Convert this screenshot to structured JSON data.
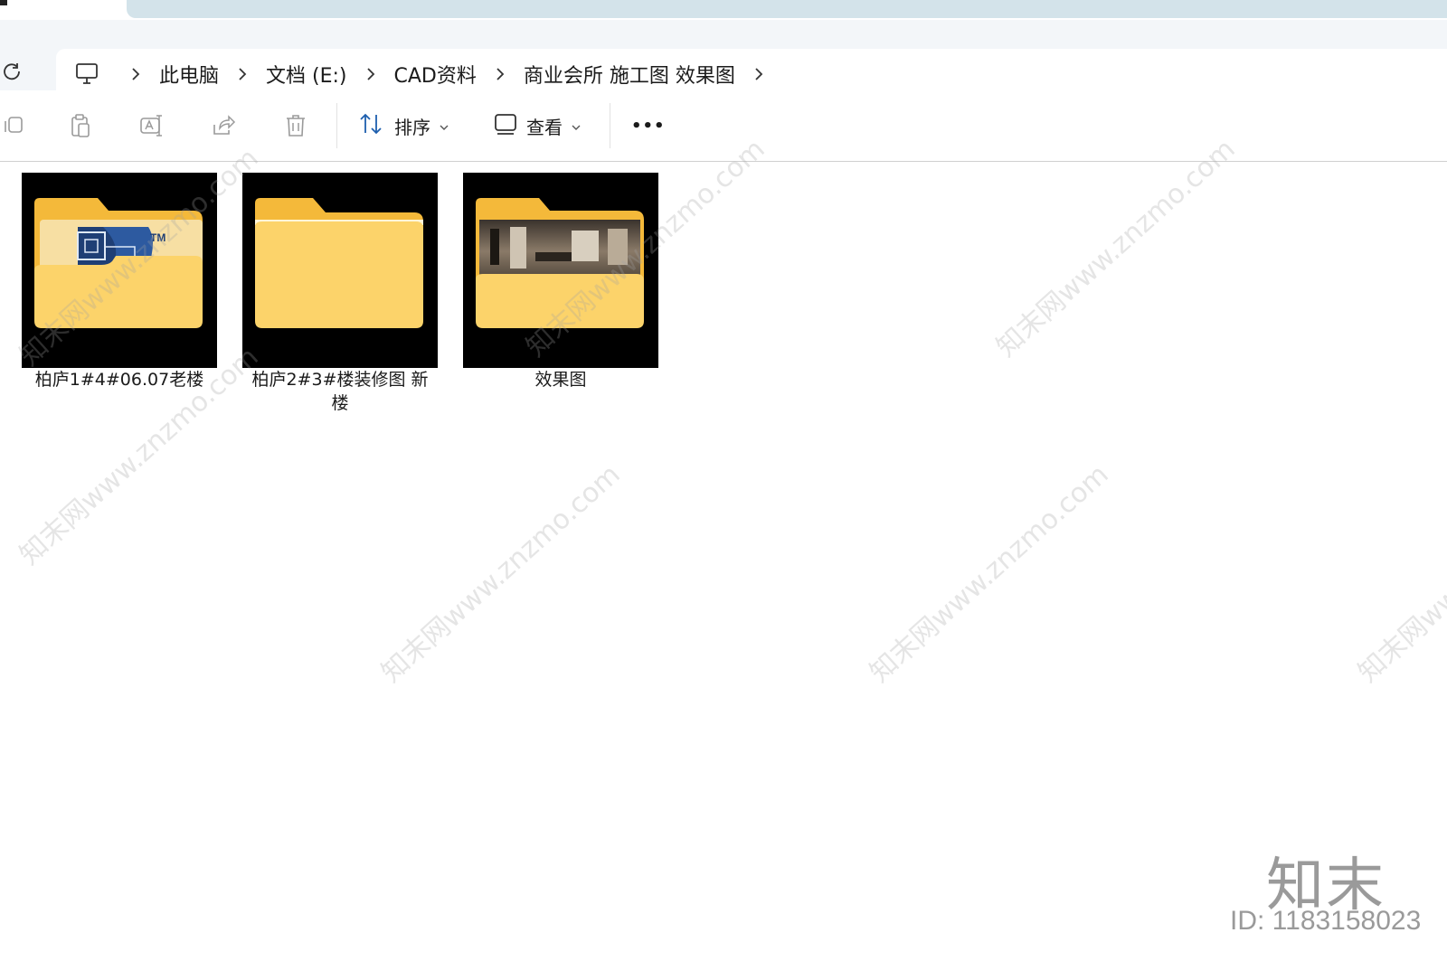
{
  "breadcrumb": {
    "items": [
      "此电脑",
      "文档 (E:)",
      "CAD资料",
      "商业会所 施工图 效果图"
    ]
  },
  "toolbar": {
    "sort_label": "排序",
    "view_label": "查看",
    "more_label": "•••"
  },
  "files": [
    {
      "name": "柏庐1#4#06.07老楼",
      "thumbnail": "folder-cad"
    },
    {
      "name": "柏庐2#3#楼装修图  新楼",
      "thumbnail": "folder-empty"
    },
    {
      "name": "效果图",
      "thumbnail": "folder-photo"
    }
  ],
  "thumbnail_labels": {
    "tm": "TM"
  },
  "watermark": {
    "text": "知末网www.znzmo.com",
    "logo": "知末",
    "id": "ID: 1183158023"
  },
  "colors": {
    "folder_back": "#f4b93a",
    "folder_front": "#fcd36a",
    "accent_blue": "#2b6cb0",
    "tab_bg": "#d3e3ea"
  }
}
